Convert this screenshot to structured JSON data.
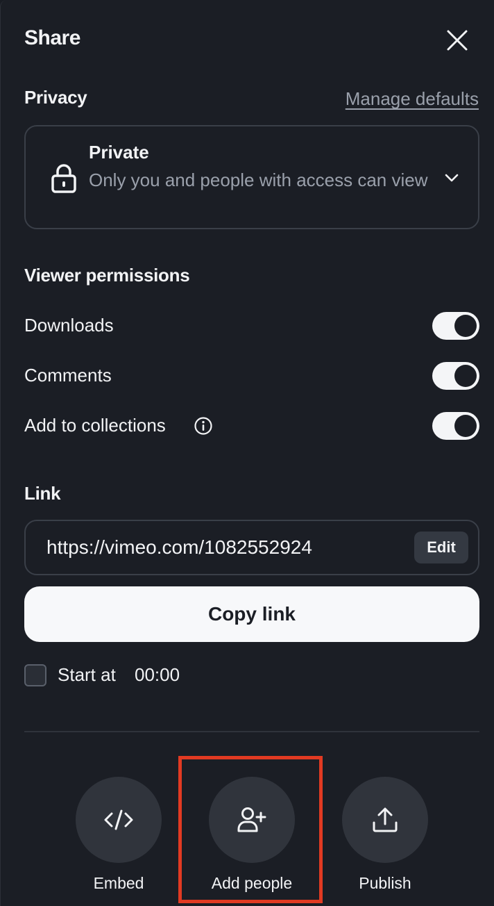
{
  "header": {
    "title": "Share"
  },
  "privacy": {
    "label": "Privacy",
    "manage_defaults": "Manage defaults",
    "selected_title": "Private",
    "selected_description": "Only you and people with access can view"
  },
  "viewer_permissions": {
    "label": "Viewer permissions",
    "items": [
      {
        "label": "Downloads",
        "enabled": true
      },
      {
        "label": "Comments",
        "enabled": true
      },
      {
        "label": "Add to collections",
        "enabled": true,
        "has_info": true
      }
    ]
  },
  "link": {
    "label": "Link",
    "url": "https://vimeo.com/1082552924",
    "edit_label": "Edit",
    "copy_label": "Copy link",
    "start_at_label": "Start at",
    "start_at_value": "00:00",
    "start_at_checked": false
  },
  "actions": [
    {
      "label": "Embed",
      "icon": "code-icon"
    },
    {
      "label": "Add people",
      "icon": "add-person-icon",
      "highlighted": true
    },
    {
      "label": "Publish",
      "icon": "upload-icon"
    }
  ],
  "colors": {
    "background": "#1b1e25",
    "text": "#f2f3f5",
    "muted": "#9aa0ab",
    "highlight": "#e23a22"
  }
}
